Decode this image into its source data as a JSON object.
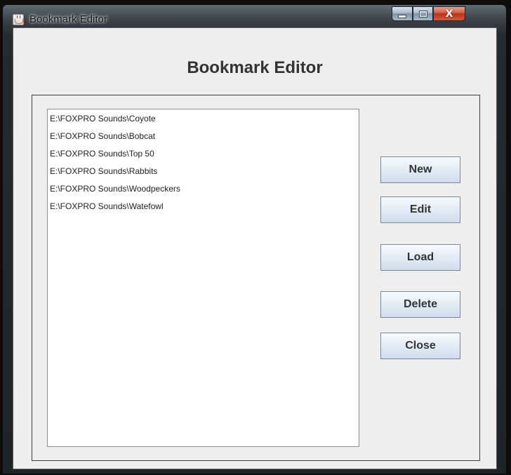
{
  "window": {
    "title": "Bookmark Editor",
    "controls": {
      "minimize_icon": "minimize-icon",
      "maximize_icon": "maximize-icon",
      "close_glyph": "X"
    }
  },
  "dialog": {
    "heading": "Bookmark Editor",
    "bookmarks": [
      "E:\\FOXPRO Sounds\\Coyote",
      "E:\\FOXPRO Sounds\\Bobcat",
      "E:\\FOXPRO Sounds\\Top 50",
      "E:\\FOXPRO Sounds\\Rabbits",
      "E:\\FOXPRO Sounds\\Woodpeckers",
      "E:\\FOXPRO Sounds\\Watefowl"
    ],
    "buttons": {
      "new_label": "New",
      "edit_label": "Edit",
      "load_label": "Load",
      "delete_label": "Delete",
      "close_label": "Close"
    }
  },
  "colors": {
    "client_bg": "#eeeeee",
    "list_bg": "#ffffff",
    "close_button_red": "#c8452a"
  }
}
